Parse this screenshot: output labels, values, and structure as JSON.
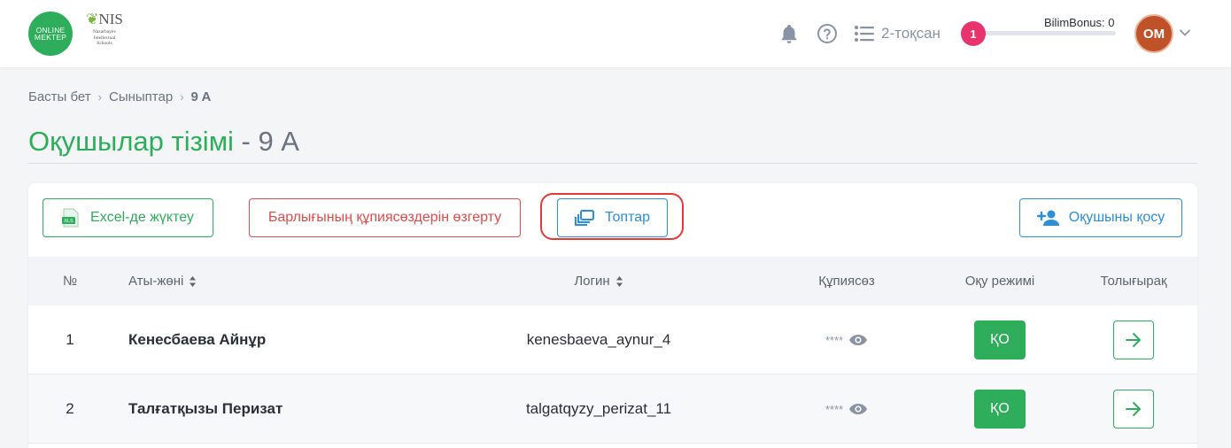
{
  "header": {
    "logo_online_line1": "ONLINE",
    "logo_online_line2": "MEKTEP",
    "logo_nis_mark": "NIS",
    "logo_nis_sub1": "Nazarbayev",
    "logo_nis_sub2": "Intellectual",
    "logo_nis_sub3": "Schools",
    "quarter_label": "2-тоқсан",
    "bonus_label": "BilimBonus: 0",
    "bonus_level": "1",
    "avatar_initials": "OM"
  },
  "breadcrumb": {
    "home": "Басты бет",
    "classes": "Сыныптар",
    "current": "9 A"
  },
  "page": {
    "title_main": "Оқушылар тізімі",
    "title_suffix": " - 9 A"
  },
  "toolbar": {
    "excel_label": "Excel-де жүктеу",
    "reset_passwords_label": "Барлығының құпиясөздерін өзгерту",
    "groups_label": "Топтар",
    "add_student_label": "Оқушыны қосу"
  },
  "table": {
    "headers": {
      "number": "№",
      "name": "Аты-жөні",
      "login": "Логин",
      "password": "Құпиясөз",
      "mode": "Оқу режимі",
      "details": "Толығырақ"
    },
    "rows": [
      {
        "number": "1",
        "name": "Кенесбаева Айнұр",
        "login": "kenesbaeva_aynur_4",
        "password": "****",
        "mode": "ҚО"
      },
      {
        "number": "2",
        "name": "Талғатқызы Перизат",
        "login": "talgatqyzy_perizat_11",
        "password": "****",
        "mode": "ҚО"
      }
    ]
  },
  "colors": {
    "brand_green": "#2eae5b",
    "accent_blue": "#2d8fd5",
    "danger_red": "#e04b4b",
    "badge_pink": "#e8336c",
    "avatar_bg": "#c0522a"
  }
}
